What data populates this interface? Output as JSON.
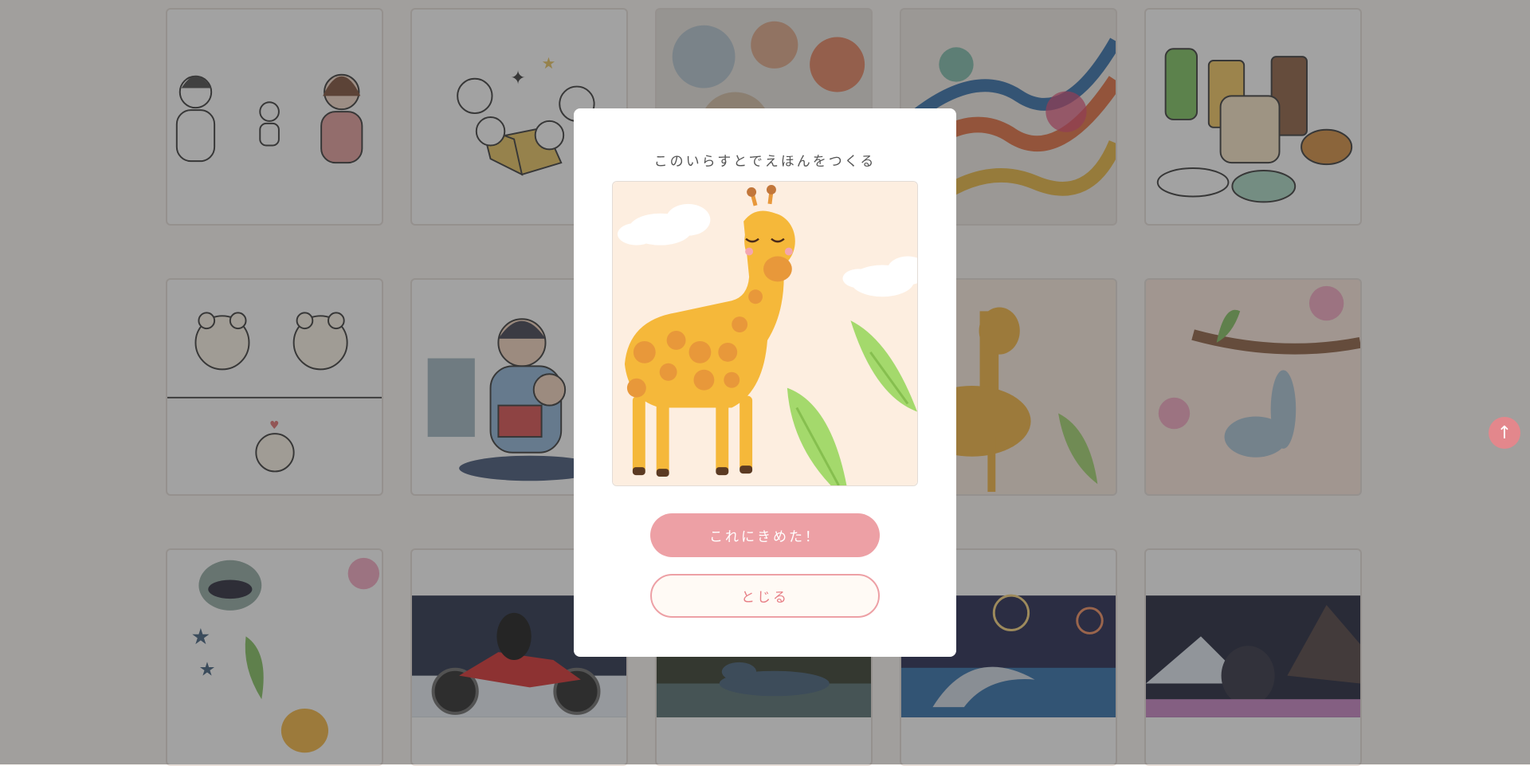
{
  "modal": {
    "title": "このいらすとでえほんをつくる",
    "preview_alt": "きりん",
    "confirm_label": "これにきめた！",
    "close_label": "とじる"
  },
  "scroll_top": {
    "icon": "↑"
  },
  "gallery": {
    "tiles": [
      "family-illustration",
      "reading-children-illustration",
      "watercolor-swirl",
      "colorful-feather-art",
      "food-illustration",
      "bears-illustration",
      "parent-child-reading",
      "giraffe-illustration",
      "giraffe-illustration-2",
      "sloth-on-branch",
      "sloth-pattern",
      "wolf-motorcycle",
      "dinosaur-forest",
      "dolphin-fireworks",
      "gorilla-night"
    ]
  },
  "colors": {
    "accent": "#eda0a5",
    "accent_text": "#e77f86",
    "overlay": "rgba(60,60,60,0.48)",
    "scroll_button": "#e3878c"
  }
}
